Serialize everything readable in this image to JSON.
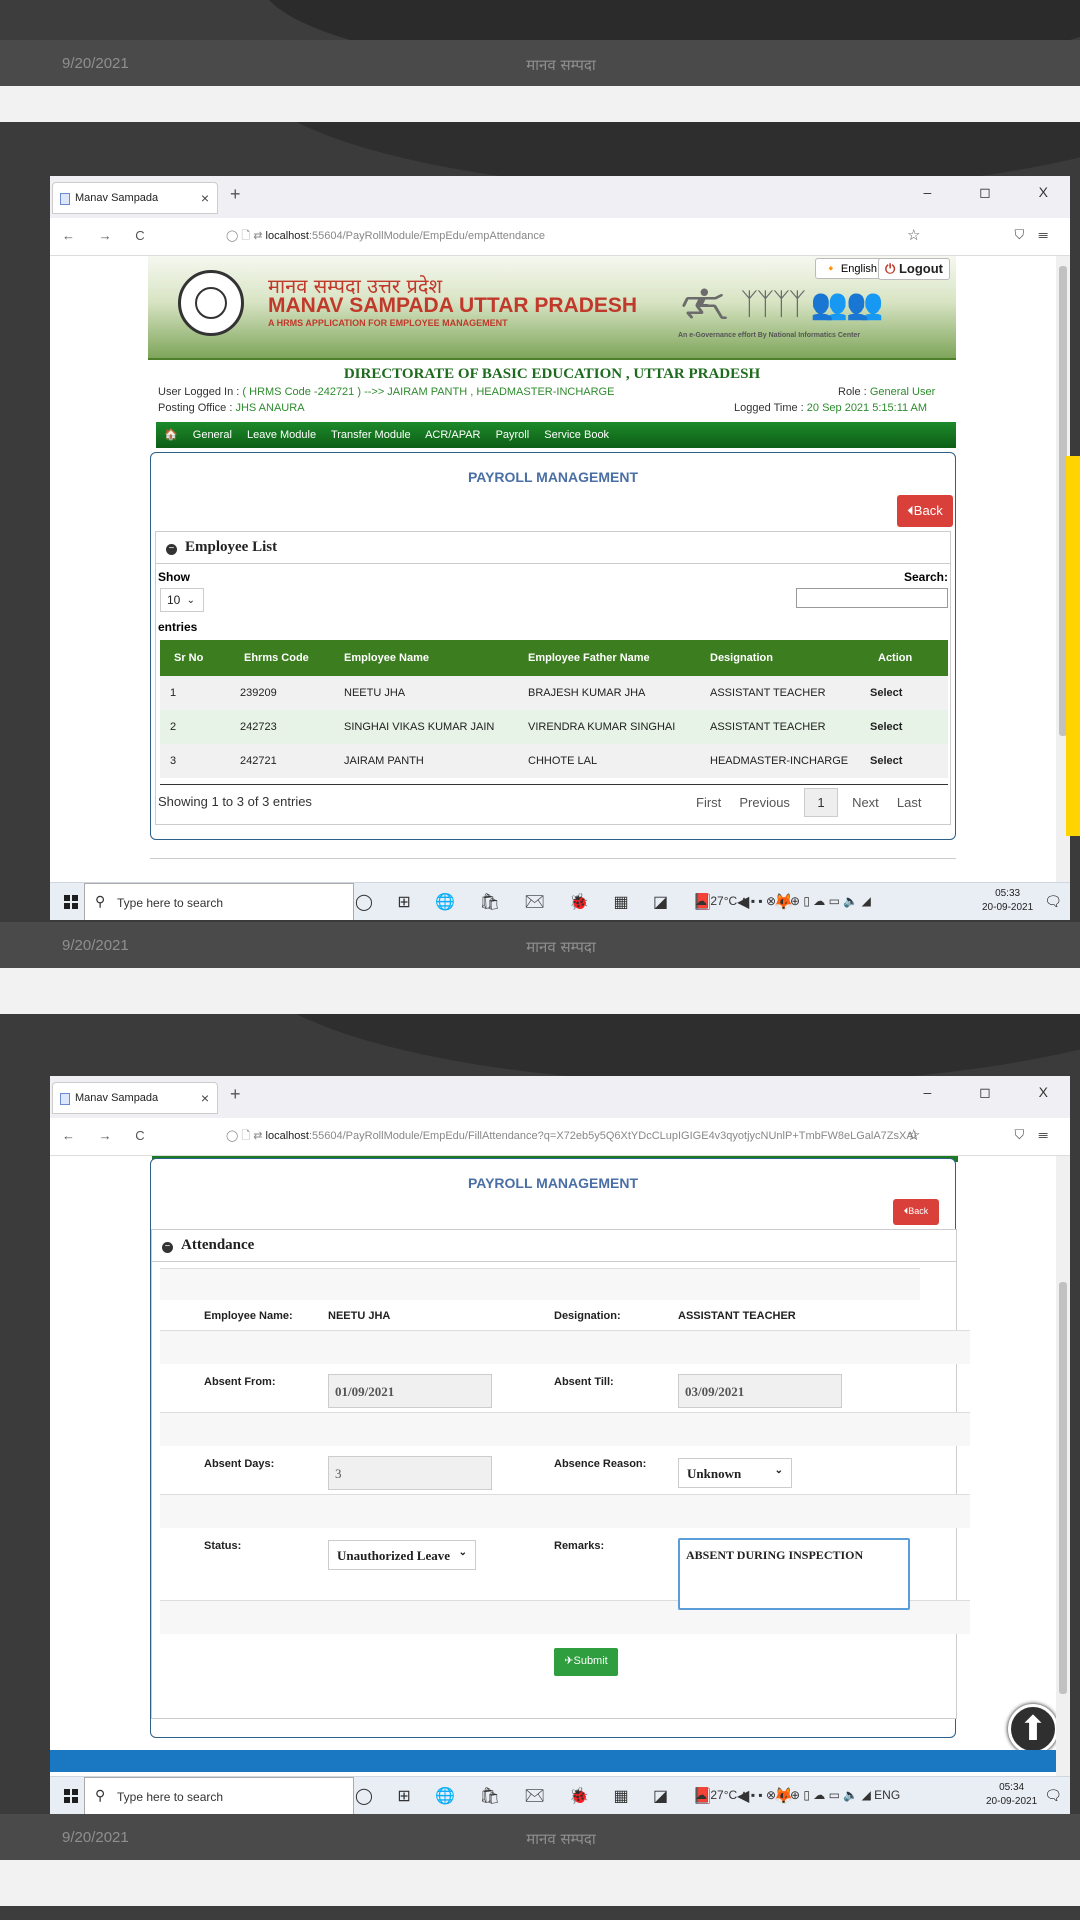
{
  "slide_footer": {
    "date": "9/20/2021",
    "title": "मानव सम्पदा"
  },
  "browser": {
    "tab_title": "Manav Sampada",
    "tab_close": "×",
    "new_tab": "+",
    "window_controls": "– ◻ X",
    "nav_arrows": "← → C",
    "rt_icons": "☰"
  },
  "shot1": {
    "url_host": "localhost",
    "url_path": ":55604/PayRollModule/EmpEdu/empAttendance",
    "banner": {
      "hindi_title": "मानव सम्पदा उत्तर प्रदेश",
      "title": "MANAV SAMPADA UTTAR PRADESH",
      "subtitle": "A HRMS APPLICATION FOR EMPLOYEE MANAGEMENT",
      "gov_text": "An e-Governance effort By National Informatics Center",
      "lang": "English",
      "logout": "Logout"
    },
    "directorate": "DIRECTORATE OF BASIC EDUCATION , UTTAR PRADESH",
    "user_logged_label": "User Logged In :",
    "user_logged_value": "( HRMS Code -242721 ) -->> JAIRAM PANTH , HEADMASTER-INCHARGE",
    "role_label": "Role :",
    "role_value": "General User",
    "posting_label": "Posting Office :",
    "posting_value": "JHS ANAURA",
    "logged_time_label": "Logged Time :",
    "logged_time_value": "20 Sep 2021 5:15:11 AM",
    "menu": [
      "General",
      "Leave Module",
      "Transfer Module",
      "ACR/APAR",
      "Payroll",
      "Service Book"
    ],
    "panel_title": "PAYROLL MANAGEMENT",
    "back": "Back",
    "section_title": "Employee List",
    "show_label": "Show",
    "show_value": "10",
    "entries_label": "entries",
    "search_label": "Search:",
    "table": {
      "headers": [
        "Sr No",
        "Ehrms Code",
        "Employee Name",
        "Employee Father Name",
        "Designation",
        "Action"
      ],
      "rows": [
        [
          "1",
          "239209",
          "NEETU JHA",
          "BRAJESH KUMAR JHA",
          "ASSISTANT TEACHER",
          "Select"
        ],
        [
          "2",
          "242723",
          "SINGHAI VIKAS KUMAR JAIN",
          "VIRENDRA KUMAR SINGHAI",
          "ASSISTANT TEACHER",
          "Select"
        ],
        [
          "3",
          "242721",
          "JAIRAM PANTH",
          "CHHOTE LAL",
          "HEADMASTER-INCHARGE",
          "Select"
        ]
      ]
    },
    "showing": "Showing 1 to 3 of 3 entries",
    "pager": {
      "first": "First",
      "previous": "Previous",
      "current": "1",
      "next": "Next",
      "last": "Last"
    }
  },
  "shot2": {
    "url_host": "localhost",
    "url_path": ":55604/PayRollModule/EmpEdu/FillAttendance?q=X72eb5y5Q6XtYDcCLupIGIGE4v3qyotjycNUnlP+TmbFW8eLGalA7ZsXAH",
    "panel_title": "PAYROLL MANAGEMENT",
    "back": "Back",
    "section_title": "Attendance",
    "employee_name_label": "Employee Name:",
    "employee_name": "NEETU JHA",
    "designation_label": "Designation:",
    "designation": "ASSISTANT TEACHER",
    "absent_from_label": "Absent From:",
    "absent_from": "01/09/2021",
    "absent_till_label": "Absent Till:",
    "absent_till": "03/09/2021",
    "absent_days_label": "Absent Days:",
    "absent_days": "3",
    "absence_reason_label": "Absence Reason:",
    "absence_reason": "Unknown",
    "status_label": "Status:",
    "status": "Unauthorized Leave",
    "remarks_label": "Remarks:",
    "remarks": "ABSENT DURING INSPECTION",
    "submit": "Submit"
  },
  "taskbar1": {
    "search_placeholder": "Type here to search",
    "temp": "27°C",
    "time": "05:33",
    "date": "20-09-2021",
    "lang": ""
  },
  "taskbar2": {
    "search_placeholder": "Type here to search",
    "temp": "27°C",
    "time": "05:34",
    "date": "20-09-2021",
    "lang": "ENG"
  }
}
